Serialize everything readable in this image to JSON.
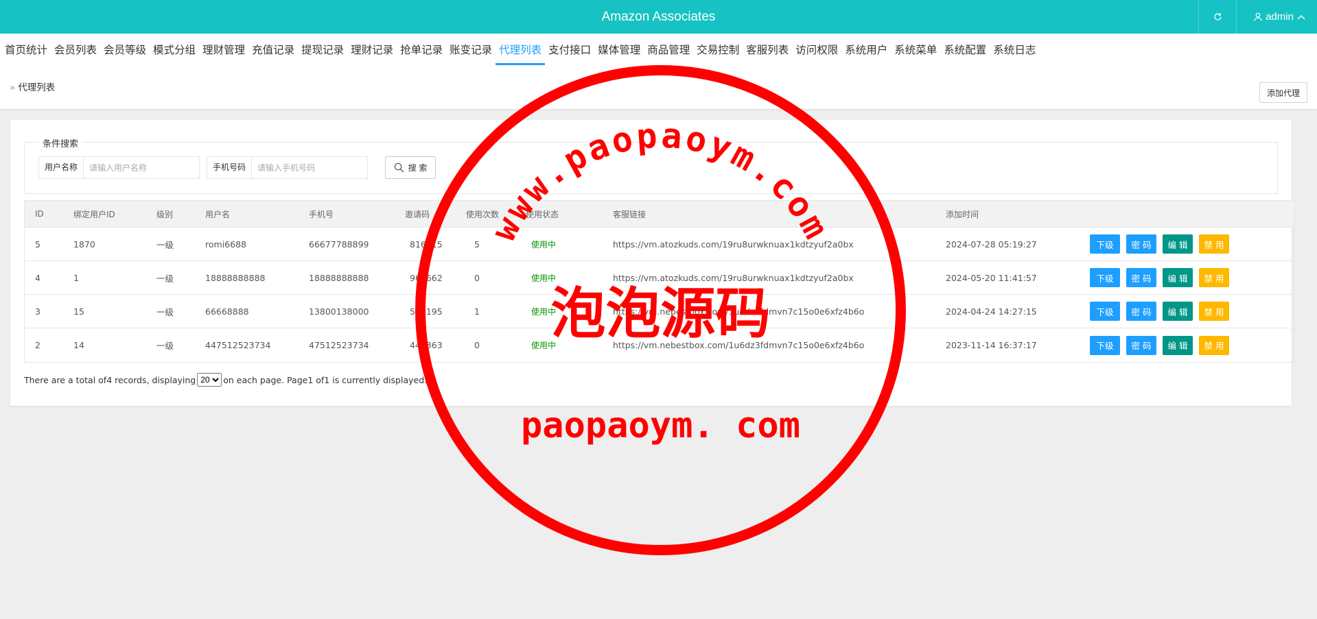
{
  "header": {
    "title": "Amazon Associates",
    "user": "admin"
  },
  "nav": {
    "items": [
      {
        "label": "首页统计"
      },
      {
        "label": "会员列表"
      },
      {
        "label": "会员等级"
      },
      {
        "label": "模式分组"
      },
      {
        "label": "理财管理"
      },
      {
        "label": "充值记录"
      },
      {
        "label": "提现记录"
      },
      {
        "label": "理财记录"
      },
      {
        "label": "抢单记录"
      },
      {
        "label": "账变记录"
      },
      {
        "label": "代理列表"
      },
      {
        "label": "支付接口"
      },
      {
        "label": "媒体管理"
      },
      {
        "label": "商品管理"
      },
      {
        "label": "交易控制"
      },
      {
        "label": "客服列表"
      },
      {
        "label": "访问权限"
      },
      {
        "label": "系统用户"
      },
      {
        "label": "系统菜单"
      },
      {
        "label": "系统配置"
      },
      {
        "label": "系统日志"
      }
    ],
    "active_index": 10
  },
  "breadcrumb": {
    "label": "代理列表",
    "add_button": "添加代理"
  },
  "search": {
    "legend": "条件搜索",
    "username_label": "用户名称",
    "username_placeholder": "请输入用户名称",
    "phone_label": "手机号码",
    "phone_placeholder": "请输入手机号码",
    "button": "搜 索"
  },
  "table": {
    "headers": {
      "id": "ID",
      "bind_uid": "绑定用户ID",
      "level": "级别",
      "username": "用户名",
      "phone": "手机号",
      "invite": "邀请码",
      "uses": "使用次数",
      "status": "使用状态",
      "link": "客服链接",
      "time": "添加时间"
    },
    "rows": [
      {
        "id": "5",
        "bind_uid": "1870",
        "level": "一级",
        "username": "romi6688",
        "phone": "66677788899",
        "invite": "816315",
        "uses": "5",
        "status": "使用中",
        "link": "https://vm.atozkuds.com/19ru8urwknuax1kdtzyuf2a0bx",
        "time": "2024-07-28 05:19:27"
      },
      {
        "id": "4",
        "bind_uid": "1",
        "level": "一级",
        "username": "18888888888",
        "phone": "18888888888",
        "invite": "960662",
        "uses": "0",
        "status": "使用中",
        "link": "https://vm.atozkuds.com/19ru8urwknuax1kdtzyuf2a0bx",
        "time": "2024-05-20 11:41:57"
      },
      {
        "id": "3",
        "bind_uid": "15",
        "level": "一级",
        "username": "66668888",
        "phone": "13800138000",
        "invite": "567195",
        "uses": "1",
        "status": "使用中",
        "link": "https://vm.nebestbox.com/1u6dz3fdmvn7c15o0e6xfz4b6o",
        "time": "2024-04-24 14:27:15"
      },
      {
        "id": "2",
        "bind_uid": "14",
        "level": "一级",
        "username": "447512523734",
        "phone": "47512523734",
        "invite": "447363",
        "uses": "0",
        "status": "使用中",
        "link": "https://vm.nebestbox.com/1u6dz3fdmvn7c15o0e6xfz4b6o",
        "time": "2023-11-14 16:37:17"
      }
    ],
    "actions": {
      "sub": "下级",
      "password": "密 码",
      "edit": "编 辑",
      "disable": "禁 用"
    }
  },
  "pager": {
    "prefix": "There are a total of4 records, displaying",
    "page_size": "20",
    "suffix": "on each page. Page1 of1 is currently displayed."
  },
  "watermark": {
    "arc_text": "www.paopaoym.com",
    "center_text": "泡泡源码",
    "bottom_text": "paopaoym. com",
    "color": "#ff0000"
  },
  "colors": {
    "header": "#16c2c3",
    "active": "#1e9fff",
    "btn_blue": "#1e9fff",
    "btn_green": "#009688",
    "btn_yellow": "#ffb800",
    "status": "#009600"
  }
}
